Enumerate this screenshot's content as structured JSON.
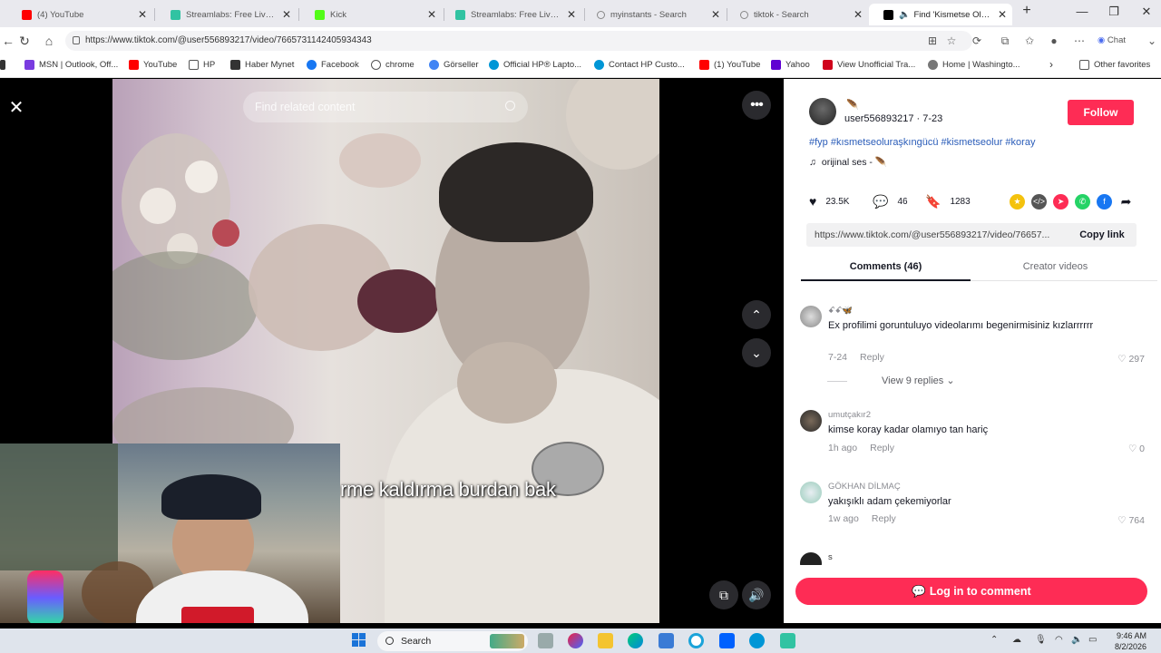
{
  "tabs": [
    {
      "title": "(4) YouTube",
      "color": "#ff0000"
    },
    {
      "title": "Streamlabs: Free Live Streami",
      "color": "#31c3a2"
    },
    {
      "title": "Kick",
      "color": "#53fc18"
    },
    {
      "title": "Streamlabs: Free Live Streami",
      "color": "#31c3a2"
    },
    {
      "title": "myinstants - Search",
      "color": "#888888"
    },
    {
      "title": "tiktok - Search",
      "color": "#888888"
    },
    {
      "title": "Find 'Kismetse Olur kon",
      "color": "#000000"
    }
  ],
  "address": {
    "url": "https://www.tiktok.com/@user556893217/video/7665731142405934343"
  },
  "bookmarks": [
    {
      "label": "MSN | Outlook, Off...",
      "color": "#7a3ce0"
    },
    {
      "label": "YouTube",
      "color": "#ff0000"
    },
    {
      "label": "HP",
      "color": "#555555"
    },
    {
      "label": "Haber Mynet",
      "color": "#333333"
    },
    {
      "label": "Facebook",
      "color": "#1877f2"
    },
    {
      "label": "chrome",
      "color": "#555555"
    },
    {
      "label": "Görseller",
      "color": "#4285f4"
    },
    {
      "label": "Official HP® Lapto...",
      "color": "#0096d6"
    },
    {
      "label": "Contact HP Custo...",
      "color": "#0096d6"
    },
    {
      "label": "(1) YouTube",
      "color": "#ff0000"
    },
    {
      "label": "Yahoo",
      "color": "#6001d2"
    },
    {
      "label": "View Unofficial Tra...",
      "color": "#d0021b"
    },
    {
      "label": "Home | Washingto...",
      "color": "#555555"
    },
    {
      "label": "Other favorites",
      "color": "#555555"
    }
  ],
  "video": {
    "search_placeholder": "Find related content",
    "caption": "rme kaldırma burdan bak"
  },
  "post": {
    "nickname": "🪶",
    "username": "user556893217 · 7-23",
    "follow_label": "Follow",
    "hashtags": "#fyp #kısmetseoluraşkıngücü #kismetseolur #koray",
    "music": "orijinal ses - 🪶",
    "likes": "23.5K",
    "comments": "46",
    "saves": "1283",
    "link": "https://www.tiktok.com/@user556893217/video/76657...",
    "copy_label": "Copy link"
  },
  "panel_tabs": {
    "comments": "Comments (46)",
    "creator": "Creator videos"
  },
  "comments": [
    {
      "name": "ꗃꗃ🦋",
      "text": "Ex profilimi goruntuluyo videolarımı begenirmisiniz kızlarrrrrr",
      "date": "7-24",
      "reply": "Reply",
      "likes": "297"
    },
    {
      "name": "umutçakır2",
      "text": "kimse koray kadar olamıyo tan hariç",
      "date": "1h ago",
      "reply": "Reply",
      "likes": "0"
    },
    {
      "name": "GÖKHAN DİLMAÇ",
      "text": "yakışıklı adam çekemiyorlar",
      "date": "1w ago",
      "reply": "Reply",
      "likes": "764"
    },
    {
      "name": "s",
      "text": "",
      "date": "",
      "reply": "",
      "likes": ""
    }
  ],
  "view_replies": "View 9 replies ⌄",
  "login_label": "Log in to comment",
  "taskbar": {
    "search_label": "Search",
    "time": "9:46 AM",
    "date": "8/2/2026"
  },
  "colors": {
    "accent": "#fe2c55",
    "hashtag": "#2b5db9"
  }
}
